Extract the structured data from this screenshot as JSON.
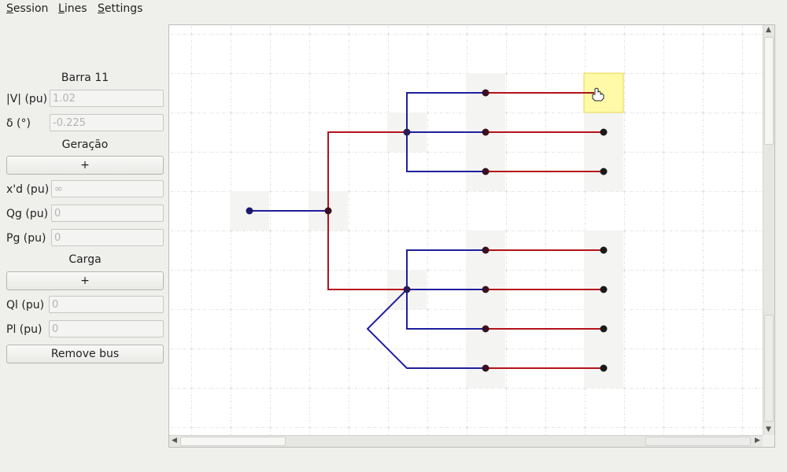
{
  "menu": {
    "session": {
      "mnemonic": "S",
      "rest": "ession"
    },
    "lines": {
      "mnemonic": "L",
      "rest": "ines"
    },
    "settings": {
      "mnemonic": "S",
      "rest": "ettings"
    }
  },
  "panel": {
    "bus_title": "Barra 11",
    "v_label": "|V| (pu)",
    "v_value": "1.02",
    "delta_label": "δ (°)",
    "delta_value": "-0.225",
    "generation_title": "Geração",
    "add_generation_label": "+",
    "xd_label": "x'd (pu)",
    "xd_value": "∞",
    "qg_label": "Qg (pu)",
    "qg_value": "0",
    "pg_label": "Pg (pu)",
    "pg_value": "0",
    "load_title": "Carga",
    "add_load_label": "+",
    "ql_label": "Ql (pu)",
    "ql_value": "0",
    "pl_label": "Pl (pu)",
    "pl_value": "0",
    "remove_bus_label": "Remove bus"
  },
  "colors": {
    "line_blue": "#1f1f9e",
    "line_red": "#b5121b",
    "node_fill": "#1a1a1a",
    "grid": "#c8c8c8",
    "selection": "#fff9a8"
  },
  "icons": {
    "cursor": "hand-pointer-icon"
  }
}
